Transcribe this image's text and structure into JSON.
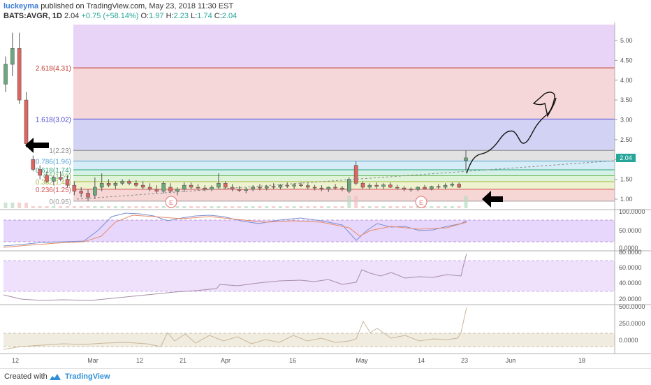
{
  "header": {
    "author": "luckeyma",
    "published_text": "published on TradingView.com, May 23, 2018 11:30 EST",
    "symbol": "BATS:AVGR, 1D",
    "last": "2.04",
    "change": "+0.75 (+58.14%)",
    "o_label": "O:",
    "o_value": "1.97",
    "h_label": "H:",
    "h_value": "2.23",
    "l_label": "L:",
    "l_value": "1.74",
    "c_label": "C:",
    "c_value": "2.04"
  },
  "footer": {
    "created_with": "Created with",
    "brand": "TradingView"
  },
  "colors": {
    "up": "#26a69a",
    "down": "#ef5350",
    "bull_fill": "#6aa87d",
    "bear_fill": "#e0645f"
  },
  "chart_data": {
    "type": "candlestick",
    "price_axis": {
      "ticks": [
        "5.00",
        "4.50",
        "4.00",
        "3.50",
        "3.00",
        "2.50",
        "2.00",
        "1.50",
        "1.00"
      ],
      "ylim": [
        0.7,
        5.4
      ],
      "last_label": "2.04"
    },
    "time_axis": {
      "ticks": [
        "12",
        "Mar",
        "12",
        "21",
        "Apr",
        "16",
        "May",
        "14",
        "23",
        "Jun",
        "18"
      ]
    },
    "fib_levels": [
      {
        "label": "2.618(4.31)",
        "value": 4.31
      },
      {
        "label": "1.618(3.02)",
        "value": 3.02
      },
      {
        "label": "1(2.23)",
        "value": 2.23
      },
      {
        "label": "0.786(1.96)",
        "value": 1.96
      },
      {
        "label": "0.618(1.74)",
        "value": 1.74
      },
      {
        "label": "0.5(1.59)",
        "value": 1.59
      },
      {
        "label": "0.382(1.44)",
        "value": 1.44
      },
      {
        "label": "0.236(1.25)",
        "value": 1.25
      },
      {
        "label": "0(0.95)",
        "value": 0.95
      }
    ],
    "earnings_markers": [
      "E",
      "E"
    ],
    "candles": [
      {
        "o": 3.9,
        "h": 4.6,
        "l": 3.7,
        "c": 4.4
      },
      {
        "o": 4.4,
        "h": 5.2,
        "l": 4.1,
        "c": 4.8
      },
      {
        "o": 4.8,
        "h": 5.2,
        "l": 3.4,
        "c": 3.5
      },
      {
        "o": 3.5,
        "h": 3.7,
        "l": 2.3,
        "c": 2.4
      },
      {
        "o": 2.0,
        "h": 2.1,
        "l": 1.7,
        "c": 1.75
      },
      {
        "o": 1.75,
        "h": 1.85,
        "l": 1.5,
        "c": 1.6
      },
      {
        "o": 1.6,
        "h": 1.7,
        "l": 1.4,
        "c": 1.45
      },
      {
        "o": 1.45,
        "h": 1.6,
        "l": 1.35,
        "c": 1.55
      },
      {
        "o": 1.55,
        "h": 1.7,
        "l": 1.45,
        "c": 1.5
      },
      {
        "o": 1.5,
        "h": 1.6,
        "l": 1.3,
        "c": 1.35
      },
      {
        "o": 1.35,
        "h": 1.45,
        "l": 1.1,
        "c": 1.2
      },
      {
        "o": 1.2,
        "h": 1.3,
        "l": 1.05,
        "c": 1.15
      },
      {
        "o": 1.15,
        "h": 1.25,
        "l": 0.95,
        "c": 1.05
      },
      {
        "o": 1.1,
        "h": 1.55,
        "l": 1.0,
        "c": 1.3
      },
      {
        "o": 1.3,
        "h": 1.65,
        "l": 1.2,
        "c": 1.4
      },
      {
        "o": 1.4,
        "h": 1.5,
        "l": 1.3,
        "c": 1.35
      },
      {
        "o": 1.35,
        "h": 1.45,
        "l": 1.25,
        "c": 1.4
      },
      {
        "o": 1.4,
        "h": 1.5,
        "l": 1.35,
        "c": 1.45
      },
      {
        "o": 1.45,
        "h": 1.5,
        "l": 1.35,
        "c": 1.4
      },
      {
        "o": 1.4,
        "h": 1.48,
        "l": 1.3,
        "c": 1.35
      },
      {
        "o": 1.35,
        "h": 1.45,
        "l": 1.25,
        "c": 1.3
      },
      {
        "o": 1.3,
        "h": 1.4,
        "l": 1.2,
        "c": 1.25
      },
      {
        "o": 1.25,
        "h": 1.35,
        "l": 1.15,
        "c": 1.2
      },
      {
        "o": 1.2,
        "h": 1.45,
        "l": 1.15,
        "c": 1.4
      },
      {
        "o": 1.3,
        "h": 1.4,
        "l": 1.15,
        "c": 1.2
      },
      {
        "o": 1.2,
        "h": 1.3,
        "l": 1.1,
        "c": 1.25
      },
      {
        "o": 1.25,
        "h": 1.42,
        "l": 1.18,
        "c": 1.35
      },
      {
        "o": 1.35,
        "h": 1.42,
        "l": 1.25,
        "c": 1.3
      },
      {
        "o": 1.3,
        "h": 1.38,
        "l": 1.22,
        "c": 1.28
      },
      {
        "o": 1.28,
        "h": 1.35,
        "l": 1.2,
        "c": 1.25
      },
      {
        "o": 1.25,
        "h": 1.35,
        "l": 1.2,
        "c": 1.3
      },
      {
        "o": 1.3,
        "h": 1.65,
        "l": 1.25,
        "c": 1.4
      },
      {
        "o": 1.4,
        "h": 1.45,
        "l": 1.25,
        "c": 1.3
      },
      {
        "o": 1.3,
        "h": 1.38,
        "l": 1.2,
        "c": 1.25
      },
      {
        "o": 1.25,
        "h": 1.33,
        "l": 1.18,
        "c": 1.22
      },
      {
        "o": 1.22,
        "h": 1.3,
        "l": 1.15,
        "c": 1.25
      },
      {
        "o": 1.25,
        "h": 1.35,
        "l": 1.2,
        "c": 1.3
      },
      {
        "o": 1.3,
        "h": 1.38,
        "l": 1.22,
        "c": 1.28
      },
      {
        "o": 1.28,
        "h": 1.36,
        "l": 1.22,
        "c": 1.32
      },
      {
        "o": 1.32,
        "h": 1.4,
        "l": 1.25,
        "c": 1.3
      },
      {
        "o": 1.3,
        "h": 1.38,
        "l": 1.24,
        "c": 1.35
      },
      {
        "o": 1.35,
        "h": 1.42,
        "l": 1.28,
        "c": 1.33
      },
      {
        "o": 1.33,
        "h": 1.4,
        "l": 1.26,
        "c": 1.36
      },
      {
        "o": 1.36,
        "h": 1.42,
        "l": 1.3,
        "c": 1.34
      },
      {
        "o": 1.34,
        "h": 1.4,
        "l": 1.25,
        "c": 1.3
      },
      {
        "o": 1.3,
        "h": 1.36,
        "l": 1.22,
        "c": 1.28
      },
      {
        "o": 1.28,
        "h": 1.35,
        "l": 1.2,
        "c": 1.25
      },
      {
        "o": 1.25,
        "h": 1.32,
        "l": 1.18,
        "c": 1.3
      },
      {
        "o": 1.3,
        "h": 1.38,
        "l": 1.24,
        "c": 1.28
      },
      {
        "o": 1.28,
        "h": 1.33,
        "l": 1.2,
        "c": 1.25
      },
      {
        "o": 1.2,
        "h": 1.55,
        "l": 1.15,
        "c": 1.5
      },
      {
        "o": 1.85,
        "h": 1.95,
        "l": 1.35,
        "c": 1.4
      },
      {
        "o": 1.4,
        "h": 1.45,
        "l": 1.25,
        "c": 1.3
      },
      {
        "o": 1.3,
        "h": 1.4,
        "l": 1.24,
        "c": 1.35
      },
      {
        "o": 1.35,
        "h": 1.42,
        "l": 1.26,
        "c": 1.32
      },
      {
        "o": 1.32,
        "h": 1.4,
        "l": 1.25,
        "c": 1.36
      },
      {
        "o": 1.36,
        "h": 1.42,
        "l": 1.28,
        "c": 1.3
      },
      {
        "o": 1.3,
        "h": 1.36,
        "l": 1.24,
        "c": 1.28
      },
      {
        "o": 1.28,
        "h": 1.33,
        "l": 1.2,
        "c": 1.25
      },
      {
        "o": 1.25,
        "h": 1.3,
        "l": 1.18,
        "c": 1.24
      },
      {
        "o": 1.24,
        "h": 1.32,
        "l": 1.2,
        "c": 1.3
      },
      {
        "o": 1.3,
        "h": 1.36,
        "l": 1.24,
        "c": 1.26
      },
      {
        "o": 1.26,
        "h": 1.34,
        "l": 1.22,
        "c": 1.32
      },
      {
        "o": 1.32,
        "h": 1.38,
        "l": 1.26,
        "c": 1.3
      },
      {
        "o": 1.3,
        "h": 1.4,
        "l": 1.25,
        "c": 1.35
      },
      {
        "o": 1.35,
        "h": 1.42,
        "l": 1.3,
        "c": 1.38
      },
      {
        "o": 1.38,
        "h": 1.42,
        "l": 1.28,
        "c": 1.3
      },
      {
        "o": 1.97,
        "h": 2.23,
        "l": 1.74,
        "c": 2.04
      }
    ]
  }
}
